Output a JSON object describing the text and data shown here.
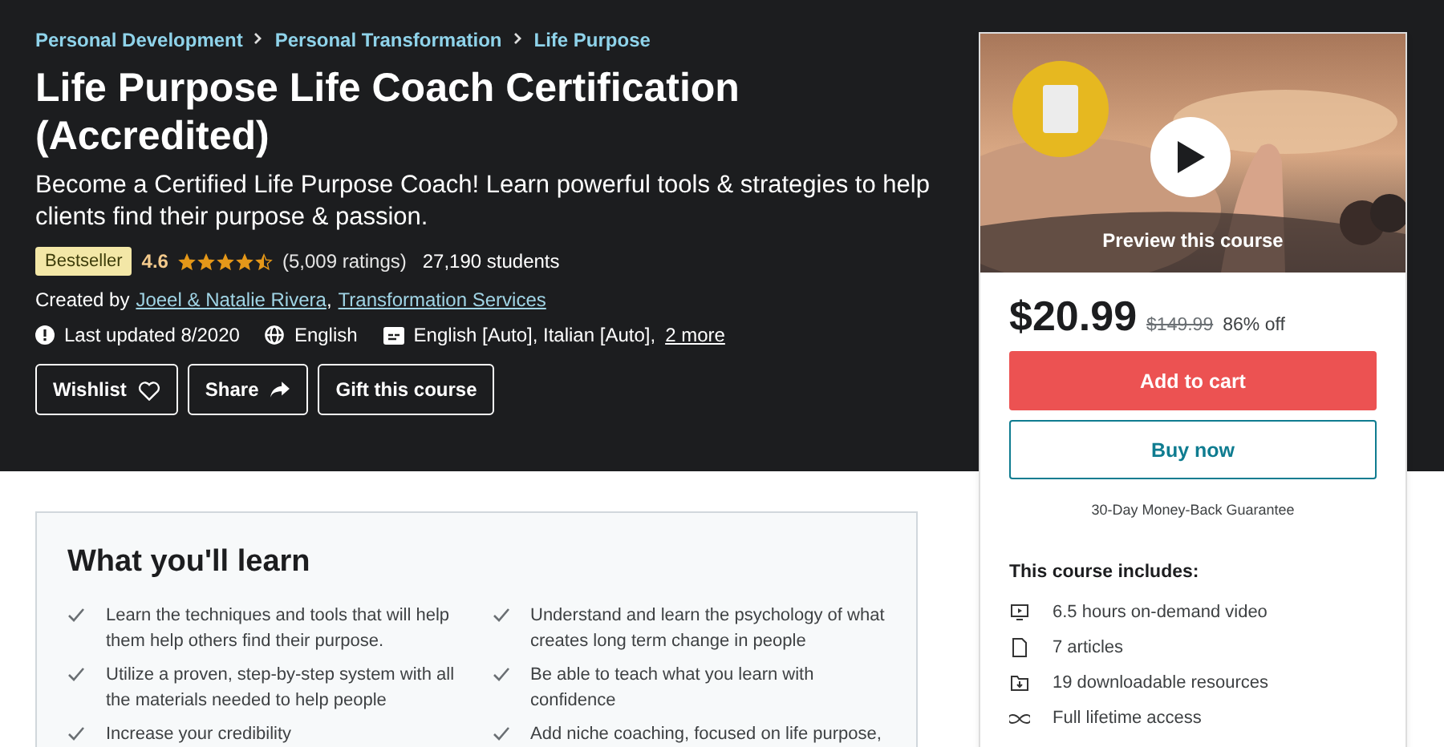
{
  "breadcrumbs": [
    "Personal Development",
    "Personal Transformation",
    "Life Purpose"
  ],
  "title": "Life Purpose Life Coach Certification (Accredited)",
  "subtitle": "Become a Certified Life Purpose Coach! Learn powerful tools & strategies to help clients find their purpose & passion.",
  "badge": "Bestseller",
  "rating": {
    "value": "4.6",
    "stars": 4.5,
    "count": "(5,009 ratings)",
    "students": "27,190 students"
  },
  "created_by": {
    "label": "Created by",
    "authors": [
      "Joeel & Natalie Rivera",
      "Transformation Services"
    ],
    "separator": ","
  },
  "meta": {
    "updated": "Last updated 8/2020",
    "language": "English",
    "captions": "English [Auto], Italian [Auto],",
    "more": "2 more"
  },
  "actions": [
    {
      "label": "Wishlist",
      "kind": "heart"
    },
    {
      "label": "Share",
      "kind": "share"
    },
    {
      "label": "Gift this course",
      "kind": "plain"
    }
  ],
  "learn": {
    "heading": "What you'll learn",
    "items": [
      {
        "text": "Learn the techniques and tools that will help them help others find their purpose."
      },
      {
        "text": "Understand and learn the psychology of what creates long term change in people"
      },
      {
        "text": "Utilize a proven, step-by-step system with all the materials needed to help people"
      },
      {
        "text": "Be able to teach what you learn with confidence"
      },
      {
        "text": "Increase your credibility"
      },
      {
        "text": "Add niche coaching, focused on life purpose,"
      }
    ]
  },
  "sidebar": {
    "preview": {
      "kind": "picture",
      "label": "Preview this course"
    },
    "price": "$20.99",
    "original_price": "$149.99",
    "discount": "86% off",
    "add_to_cart": "Add to cart",
    "buy_now": "Buy now",
    "guarantee": "30-Day Money-Back Guarantee",
    "includes_heading": "This course includes:",
    "includes": [
      {
        "kind": "video",
        "text": "6.5 hours on-demand video"
      },
      {
        "kind": "article",
        "text": "7 articles"
      },
      {
        "kind": "download",
        "text": "19 downloadable resources"
      },
      {
        "kind": "infinity",
        "text": "Full lifetime access"
      }
    ]
  }
}
